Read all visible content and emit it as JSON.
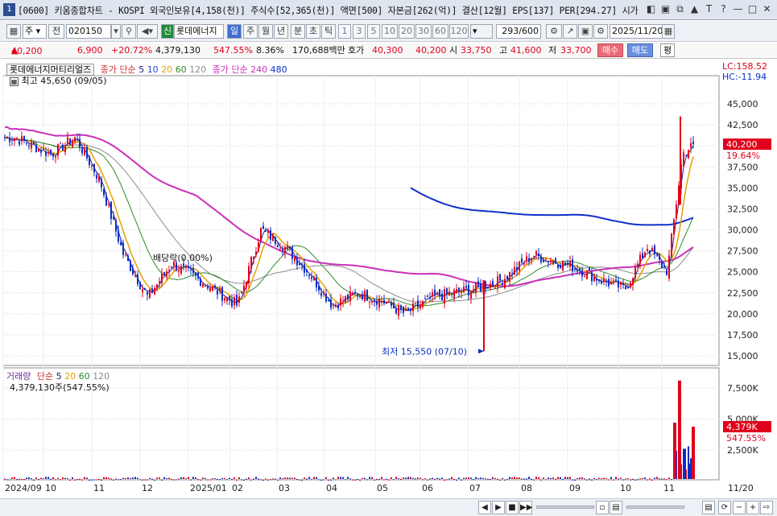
{
  "window": {
    "number": "1",
    "title": "[0600] 키움종합차트 - KOSPI 외국인보유[4,158(천)] 주식수[52,365(천)] 액면[500] 자본금[262(억)] 결산[12월] EPS[137] PER[294.27] 시가"
  },
  "toolbar": {
    "period_type": "주",
    "prev_label": "전",
    "stock_code": "020150",
    "credit_label": "신",
    "stock_name": "롯데에너지",
    "period_buttons": [
      "일",
      "주",
      "월",
      "년",
      "분",
      "초",
      "틱"
    ],
    "active_period": "일",
    "intervals": [
      "1",
      "3",
      "5",
      "10",
      "20",
      "30",
      "60",
      "120"
    ],
    "count": "293",
    "total": "/600",
    "date": "2025/11/20"
  },
  "quote": {
    "price": "40,200",
    "change": "6,900",
    "change_pct": "+20.72%",
    "volume": "4,379,130",
    "volume_pct": "547.55%",
    "turnover": "8.36%",
    "amount": "170,688백만",
    "bid_label": "호가",
    "bid1": "40,300",
    "bid2": "40,200",
    "open_label": "시",
    "open": "33,750",
    "high_label": "고",
    "high": "41,600",
    "low_label": "저",
    "low": "33,700",
    "buy_label": "매수",
    "sell_label": "매도",
    "avg_label": "평"
  },
  "price_panel": {
    "stock_title": "롯데에너지머티리얼즈",
    "ma_label": "종가 단순",
    "ma_short": [
      "5",
      "10",
      "20",
      "60",
      "120"
    ],
    "ma_long_label": "종가 단순",
    "ma_long": [
      "240",
      "480"
    ],
    "lc": "LC:158.52",
    "hc": "HC:-11.94",
    "high_note": "최고 45,650 (09/05)",
    "low_note": "최저 15,550 (07/10)",
    "event_note": "배당락(0.00%)",
    "last_price": "40,200",
    "last_pct": "19.64%",
    "y_ticks": [
      "45,000",
      "42,500",
      "40,000",
      "37,500",
      "35,000",
      "32,500",
      "30,000",
      "27,500",
      "25,000",
      "22,500",
      "20,000",
      "17,500",
      "15,000"
    ]
  },
  "volume_panel": {
    "title": "거래량",
    "ma_label": "단순",
    "ma": [
      "5",
      "20",
      "60",
      "120"
    ],
    "value": "4,379,130주(547.55%)",
    "y_ticks": [
      "7,500K",
      "5,000K",
      "2,500K"
    ],
    "last_value": "4,379K",
    "last_pct": "547.55%"
  },
  "x_axis": [
    "2024/09",
    "10",
    "11",
    "12",
    "2025/01",
    "02",
    "03",
    "04",
    "05",
    "06",
    "07",
    "08",
    "09",
    "10",
    "11",
    "11/20"
  ],
  "colors": {
    "up": "#e0001b",
    "down": "#0b2fc4",
    "ma5": "#1c1c8c",
    "ma10": "#6b2b9a",
    "ma20": "#e6a100",
    "ma60": "#2d8a2d",
    "ma120": "#8c8c8c",
    "ma240": "#cc2fb9",
    "ma480": "#1030c8",
    "lc": "#e0001b",
    "hc": "#1030c8"
  },
  "chart_data": {
    "type": "candlestick",
    "x_start": "2024/09",
    "x_end": "2025/11/20",
    "ylim": [
      14000,
      46000
    ],
    "y_scale_anchor": [
      [
        45000,
        15000
      ]
    ],
    "approx_close_path": [
      [
        "2024/09",
        41000
      ],
      [
        "2024/10",
        39000
      ],
      [
        "2024/10",
        41000
      ],
      [
        "2024/11",
        36000
      ],
      [
        "2024/11",
        27000
      ],
      [
        "2024/12",
        22000
      ],
      [
        "2024/12",
        26000
      ],
      [
        "2025/01",
        24000
      ],
      [
        "2025/02",
        21000
      ],
      [
        "2025/02",
        30000
      ],
      [
        "2025/03",
        28000
      ],
      [
        "2025/03",
        25000
      ],
      [
        "2025/04",
        21000
      ],
      [
        "2025/04",
        22500
      ],
      [
        "2025/05",
        21500
      ],
      [
        "2025/05",
        20000
      ],
      [
        "2025/06",
        22000
      ],
      [
        "2025/07",
        23000
      ],
      [
        "2025/07",
        24000
      ],
      [
        "2025/08",
        27000
      ],
      [
        "2025/09",
        25500
      ],
      [
        "2025/09",
        24000
      ],
      [
        "2025/10",
        23000
      ],
      [
        "2025/10",
        28000
      ],
      [
        "2025/11",
        25000
      ],
      [
        "2025/11",
        39000
      ],
      [
        "2025/11/20",
        40200
      ]
    ],
    "annotations": {
      "high": 45650,
      "low": 15550,
      "last": 40200
    },
    "grid": true
  }
}
